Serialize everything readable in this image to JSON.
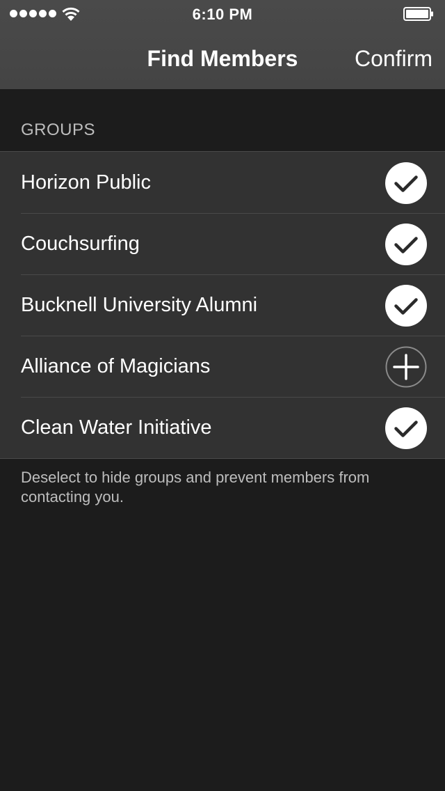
{
  "status_bar": {
    "time": "6:10 PM",
    "signal_icon": "signal-dots-icon",
    "wifi_icon": "wifi-icon",
    "battery_icon": "battery-full-icon"
  },
  "nav": {
    "title": "Find Members",
    "confirm_label": "Confirm"
  },
  "section": {
    "header": "GROUPS"
  },
  "groups": [
    {
      "name": "Horizon Public",
      "selected": true,
      "icon": "checkmark-circle-icon"
    },
    {
      "name": "Couchsurfing",
      "selected": true,
      "icon": "checkmark-circle-icon"
    },
    {
      "name": "Bucknell University Alumni",
      "selected": true,
      "icon": "checkmark-circle-icon"
    },
    {
      "name": "Alliance of Magicians",
      "selected": false,
      "icon": "plus-circle-icon"
    },
    {
      "name": "Clean Water Initiative",
      "selected": true,
      "icon": "checkmark-circle-icon"
    }
  ],
  "footer_note": "Deselect to hide groups and prevent members from contacting you.",
  "colors": {
    "nav_background": "#484848",
    "page_background": "#1c1c1c",
    "row_background": "#323232",
    "secondary_text": "#bdbdbd",
    "checkmark": "#2a2a2a"
  }
}
